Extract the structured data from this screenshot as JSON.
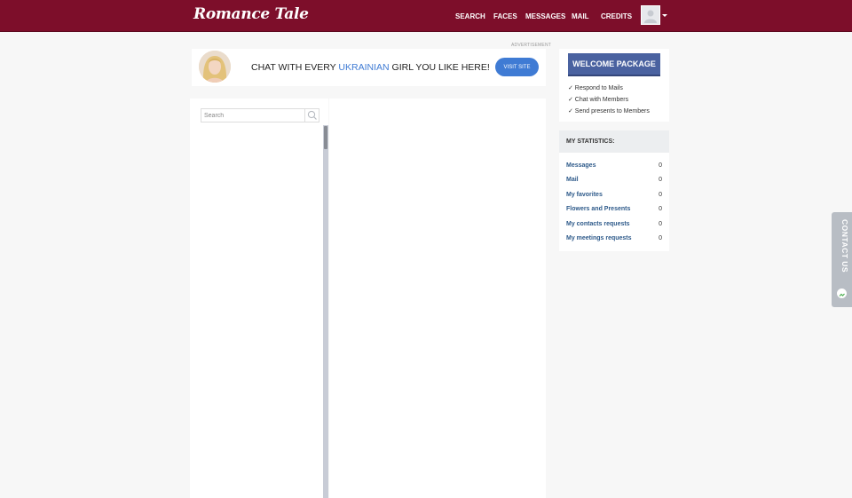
{
  "header": {
    "logo": "Romance Tale",
    "nav": [
      {
        "label": "SEARCH"
      },
      {
        "label": "FACES"
      },
      {
        "label": "MESSAGES"
      },
      {
        "label": "MAIL"
      },
      {
        "label": "CREDITS"
      }
    ]
  },
  "ad": {
    "label": "ADVERTISEMENT",
    "text_before": "CHAT WITH EVERY ",
    "highlight": "UKRAINIAN",
    "text_after": " GIRL YOU LIKE HERE!",
    "button": "VISIT SITE",
    "accent_color": "#3f7bd4"
  },
  "chat_list": {
    "search_placeholder": "Search"
  },
  "welcome": {
    "button": "WELCOME PACKAGE",
    "benefits": [
      "✓ Respond to Mails",
      "✓ Chat with Members",
      "✓ Send presents to Members"
    ]
  },
  "statistics": {
    "header": "MY STATISTICS:",
    "rows": [
      {
        "label": "Messages",
        "value": "0"
      },
      {
        "label": "Mail",
        "value": "0"
      },
      {
        "label": "My favorites",
        "value": "0"
      },
      {
        "label": "Flowers and Presents",
        "value": "0"
      },
      {
        "label": "My contacts requests",
        "value": "0"
      },
      {
        "label": "My meetings requests",
        "value": "0"
      }
    ]
  },
  "contact_tab": {
    "label": "CONTACT US"
  },
  "colors": {
    "brand": "#7d0e2a",
    "welcome_button": "#4a62a0",
    "stat_link": "#2e5a8a"
  }
}
